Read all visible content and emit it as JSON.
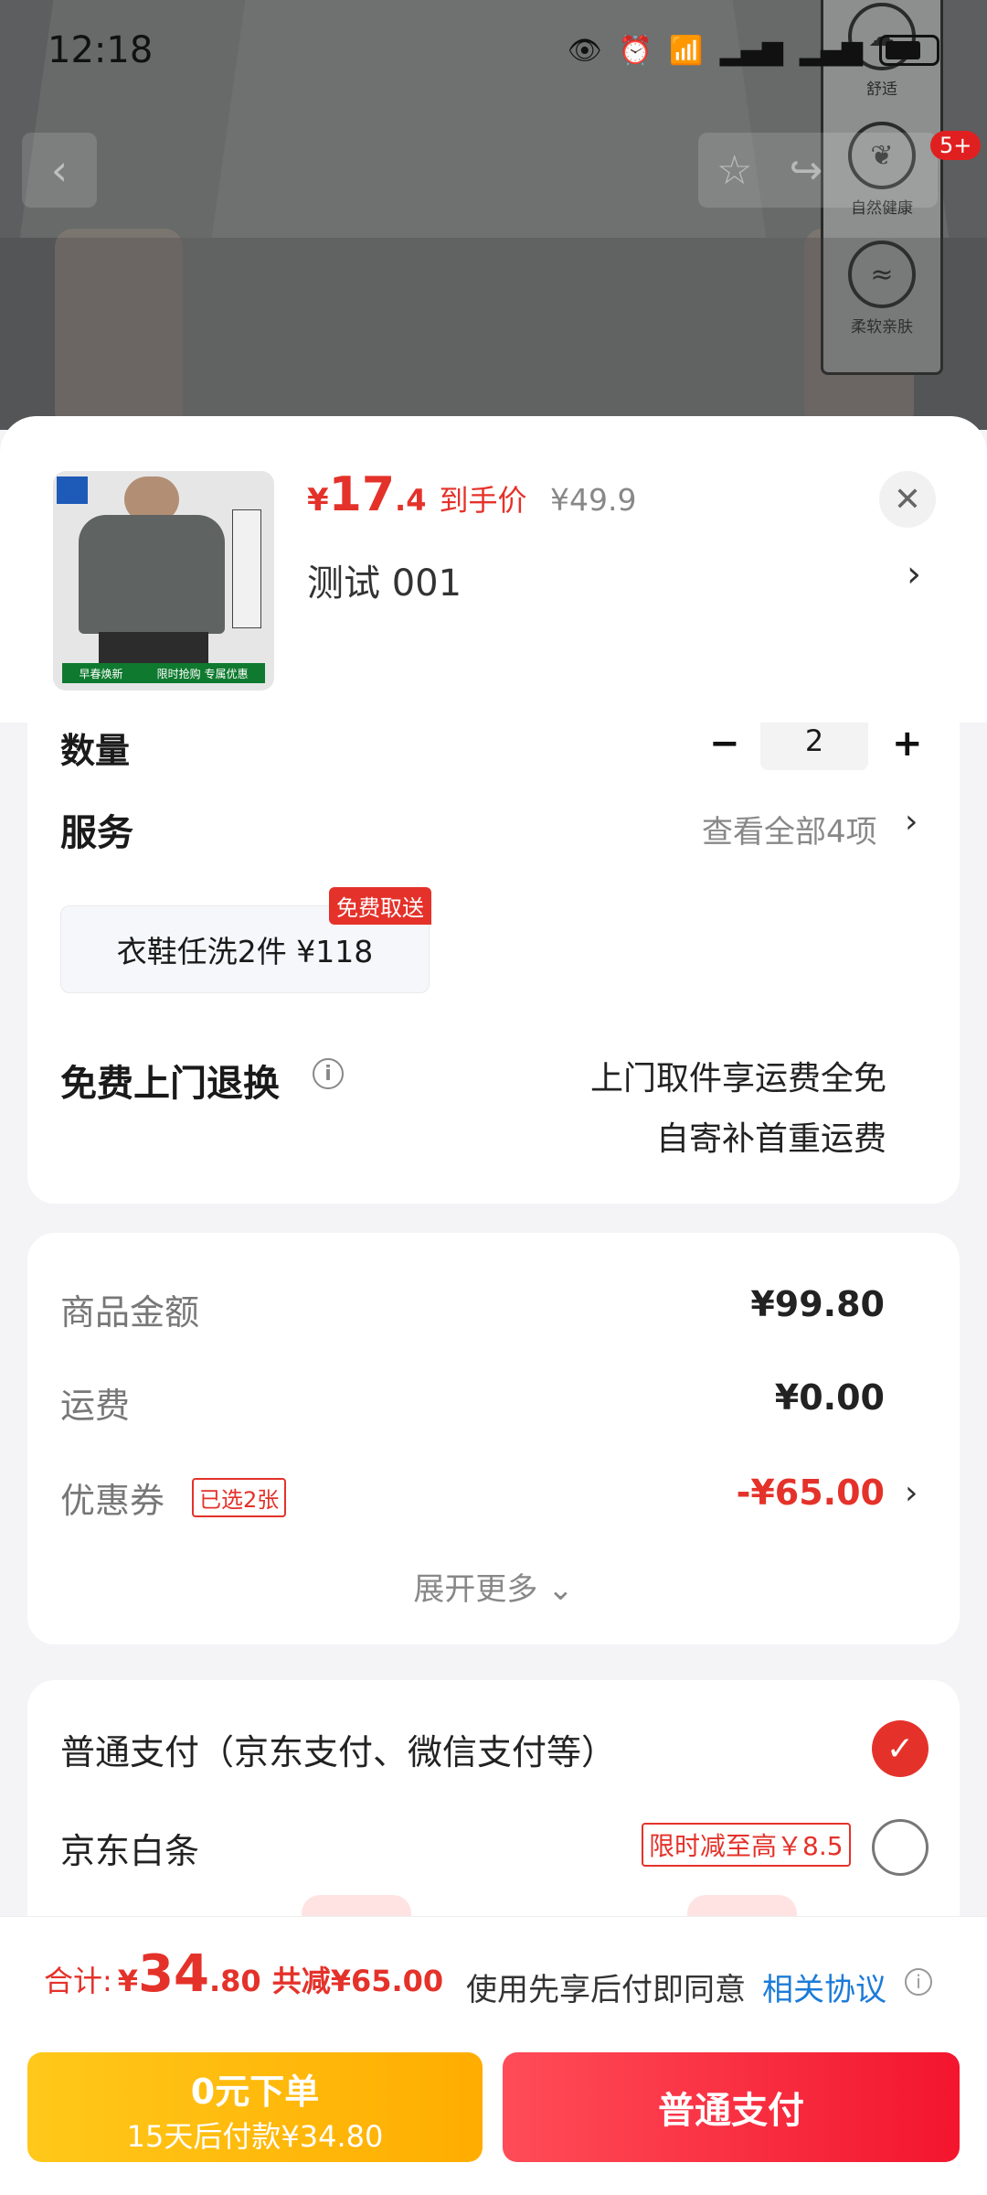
{
  "status_bar": {
    "time": "12:18"
  },
  "background_product": {
    "features": [
      "舒适",
      "自然健康",
      "柔软亲肤"
    ],
    "cart_badge": "5+"
  },
  "sheet": {
    "price": {
      "yen": "¥",
      "int": "17",
      "dec": ".4",
      "tag": "到手价"
    },
    "original_price": "¥49.9",
    "variant": "测试  001",
    "thumb_banner": [
      "早春焕新",
      "限时抢购 专属优惠"
    ],
    "quantity": {
      "label": "数量",
      "value": "2",
      "minus": "−",
      "plus": "+"
    },
    "service": {
      "title": "服务",
      "view_all": "查看全部4项",
      "option": "衣鞋任洗2件  ¥118",
      "badge": "免费取送"
    },
    "returns": {
      "title": "免费上门退换",
      "line1": "上门取件享运费全免",
      "line2": "自寄补首重运费"
    },
    "summary": {
      "goods_label": "商品金额",
      "goods_value": "¥99.80",
      "shipping_label": "运费",
      "shipping_value": "¥0.00",
      "coupon_label": "优惠券",
      "coupon_tag": "已选2张",
      "coupon_value": "-¥65.00",
      "expand": "展开更多"
    },
    "payment": {
      "normal": "普通支付（京东支付、微信支付等）",
      "baitiao": "京东白条",
      "baitiao_promo": "限时减至高￥8.5"
    }
  },
  "footer": {
    "total_label": "合计:",
    "total_yen": "¥",
    "total_int": "34",
    "total_dec": ".80",
    "total_saved": "共减¥65.00",
    "agreement_text": "使用先享后付即同意",
    "agreement_link": "相关协议",
    "btn_left_line1": "0元下单",
    "btn_left_line2": "15天后付款¥34.80",
    "btn_right": "普通支付"
  },
  "colors": {
    "accent_red": "#e4322a",
    "link_blue": "#1c7bd8",
    "gold": "#ffc81a"
  }
}
